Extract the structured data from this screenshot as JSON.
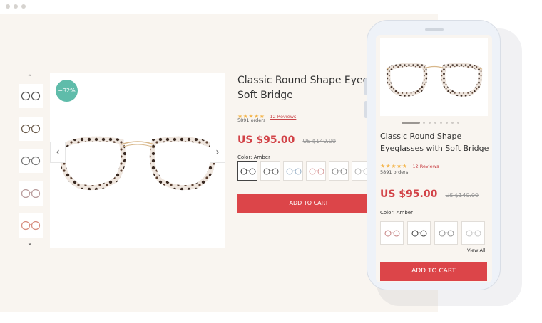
{
  "desktop": {
    "badge": "−32%",
    "title": "Classic Round Shape Eyeglasses with Soft Bridge",
    "title_line1": "Classic Round Shape Eyeglass",
    "title_line2": "Soft Bridge",
    "stars": "★★★★★",
    "reviews": "12 Reviews",
    "orders": "5891 orders",
    "price": "US $95.00",
    "old_price": "US $140.00",
    "color_label": "Color: Amber",
    "add_to_cart": "ADD TO CART",
    "thumb_up": "⌃",
    "thumb_down": "⌄",
    "prev": "‹",
    "next": "›",
    "swatch_colors": [
      "#3a3a3a",
      "#5a5a5a",
      "#9bb3c9",
      "#d99a9a",
      "#8a8a8a",
      "#b7b7b7"
    ],
    "thumb_colors": [
      "#555555",
      "#6a5a4a",
      "#777777",
      "#b89a9a",
      "#d68c7e"
    ]
  },
  "mobile": {
    "title": "Classic Round Shape Eyeglasses with Soft Bridge",
    "stars": "★★★★★",
    "reviews": "12 Reviews",
    "orders": "5891 orders",
    "price": "US $95.00",
    "old_price": "US $140.00",
    "color_label": "Color: Amber",
    "view_all": "View All",
    "add_to_cart": "ADD TO CART",
    "swatch_colors": [
      "#c98a8a",
      "#4a4a4a",
      "#9a9a9a",
      "#c9c9c9"
    ]
  },
  "colors": {
    "accent": "#dc4549",
    "badge": "#5fbcaa",
    "star": "#f4b54b",
    "background": "#f9f5f0"
  }
}
